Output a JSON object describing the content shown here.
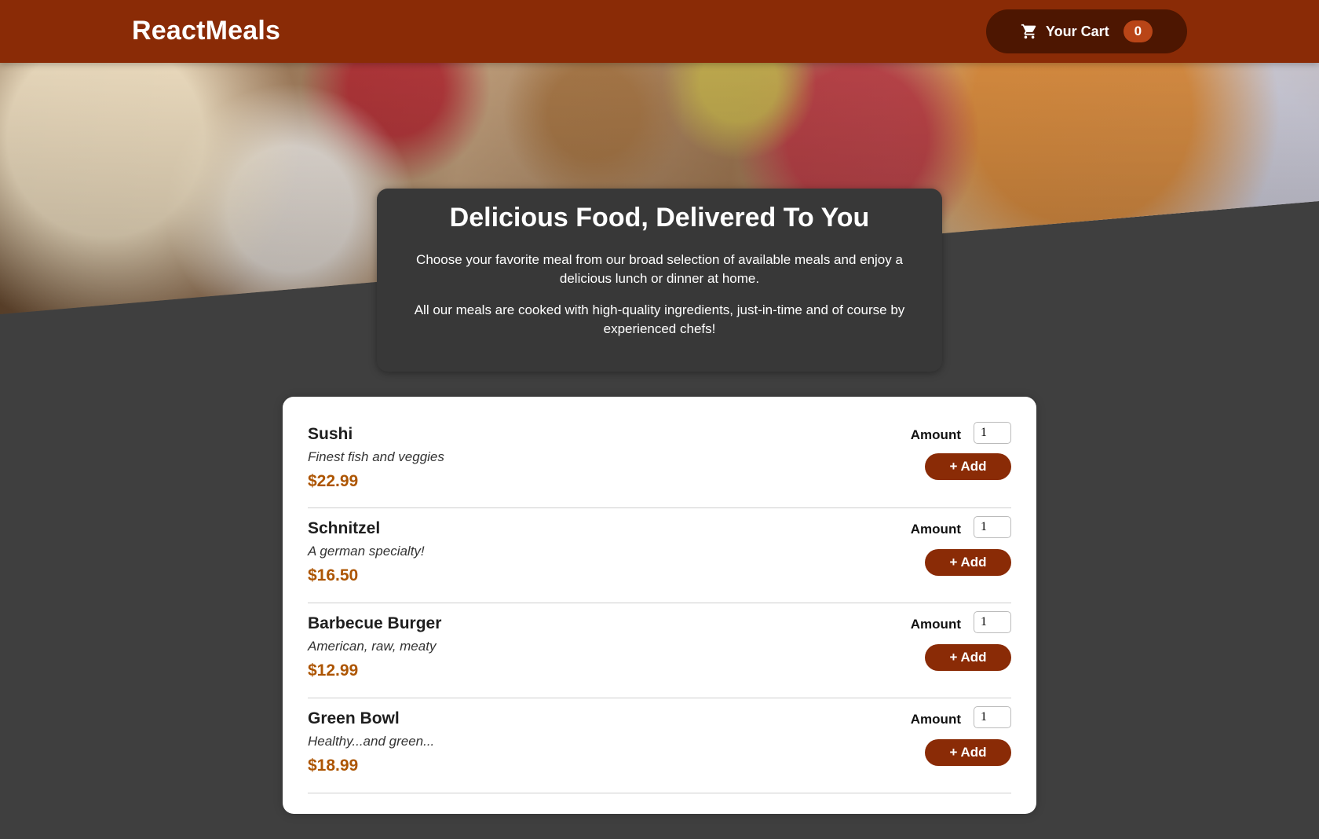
{
  "header": {
    "logo": "ReactMeals",
    "cart_label": "Your Cart",
    "cart_count": "0"
  },
  "summary": {
    "title": "Delicious Food, Delivered To You",
    "paragraph1": "Choose your favorite meal from our broad selection of available meals and enjoy a delicious lunch or dinner at home.",
    "paragraph2": "All our meals are cooked with high-quality ingredients, just-in-time and of course by experienced chefs!"
  },
  "meals": [
    {
      "name": "Sushi",
      "description": "Finest fish and veggies",
      "price": "$22.99",
      "amount_label": "Amount",
      "amount": "1",
      "add_label": "+ Add"
    },
    {
      "name": "Schnitzel",
      "description": "A german specialty!",
      "price": "$16.50",
      "amount_label": "Amount",
      "amount": "1",
      "add_label": "+ Add"
    },
    {
      "name": "Barbecue Burger",
      "description": "American, raw, meaty",
      "price": "$12.99",
      "amount_label": "Amount",
      "amount": "1",
      "add_label": "+ Add"
    },
    {
      "name": "Green Bowl",
      "description": "Healthy...and green...",
      "price": "$18.99",
      "amount_label": "Amount",
      "amount": "1",
      "add_label": "+ Add"
    }
  ],
  "colors": {
    "header_bg": "#8a2b06",
    "cart_bg": "#4d1601",
    "badge_bg": "#b94517",
    "price": "#ad5502",
    "page_bg": "#3f3f3f"
  }
}
